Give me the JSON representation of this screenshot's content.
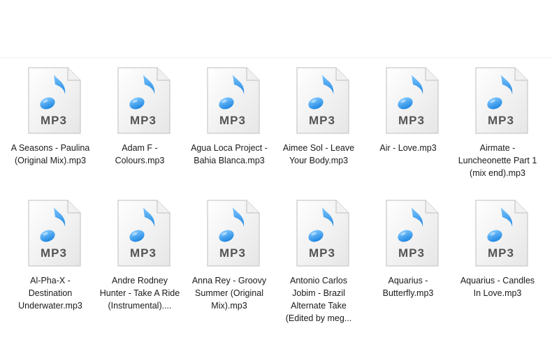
{
  "files": [
    {
      "name": "A Seasons - Paulina (Original Mix).mp3",
      "badge": "MP3"
    },
    {
      "name": "Adam F - Colours.mp3",
      "badge": "MP3"
    },
    {
      "name": "Agua Loca Project - Bahia Blanca.mp3",
      "badge": "MP3"
    },
    {
      "name": "Aimee Sol - Leave Your Body.mp3",
      "badge": "MP3"
    },
    {
      "name": "Air - Love.mp3",
      "badge": "MP3"
    },
    {
      "name": "Airmate - Luncheonette Part 1 (mix end).mp3",
      "badge": "MP3"
    },
    {
      "name": "Al-Pha-X - Destination Underwater.mp3",
      "badge": "MP3"
    },
    {
      "name": "Andre Rodney Hunter - Take A Ride (Instrumental)....",
      "badge": "MP3"
    },
    {
      "name": "Anna Rey - Groovy Summer (Original Mix).mp3",
      "badge": "MP3"
    },
    {
      "name": "Antonio Carlos Jobim - Brazil Alternate Take (Edited by meg...",
      "badge": "MP3"
    },
    {
      "name": "Aquarius - Butterfly.mp3",
      "badge": "MP3"
    },
    {
      "name": "Aquarius - Candles In Love.mp3",
      "badge": "MP3"
    }
  ],
  "icon": "mp3-file-icon",
  "colors": {
    "note_light": "#7cc6ff",
    "note_dark": "#1f86e0",
    "paper": "#f4f4f4",
    "badge_text": "#555555"
  }
}
